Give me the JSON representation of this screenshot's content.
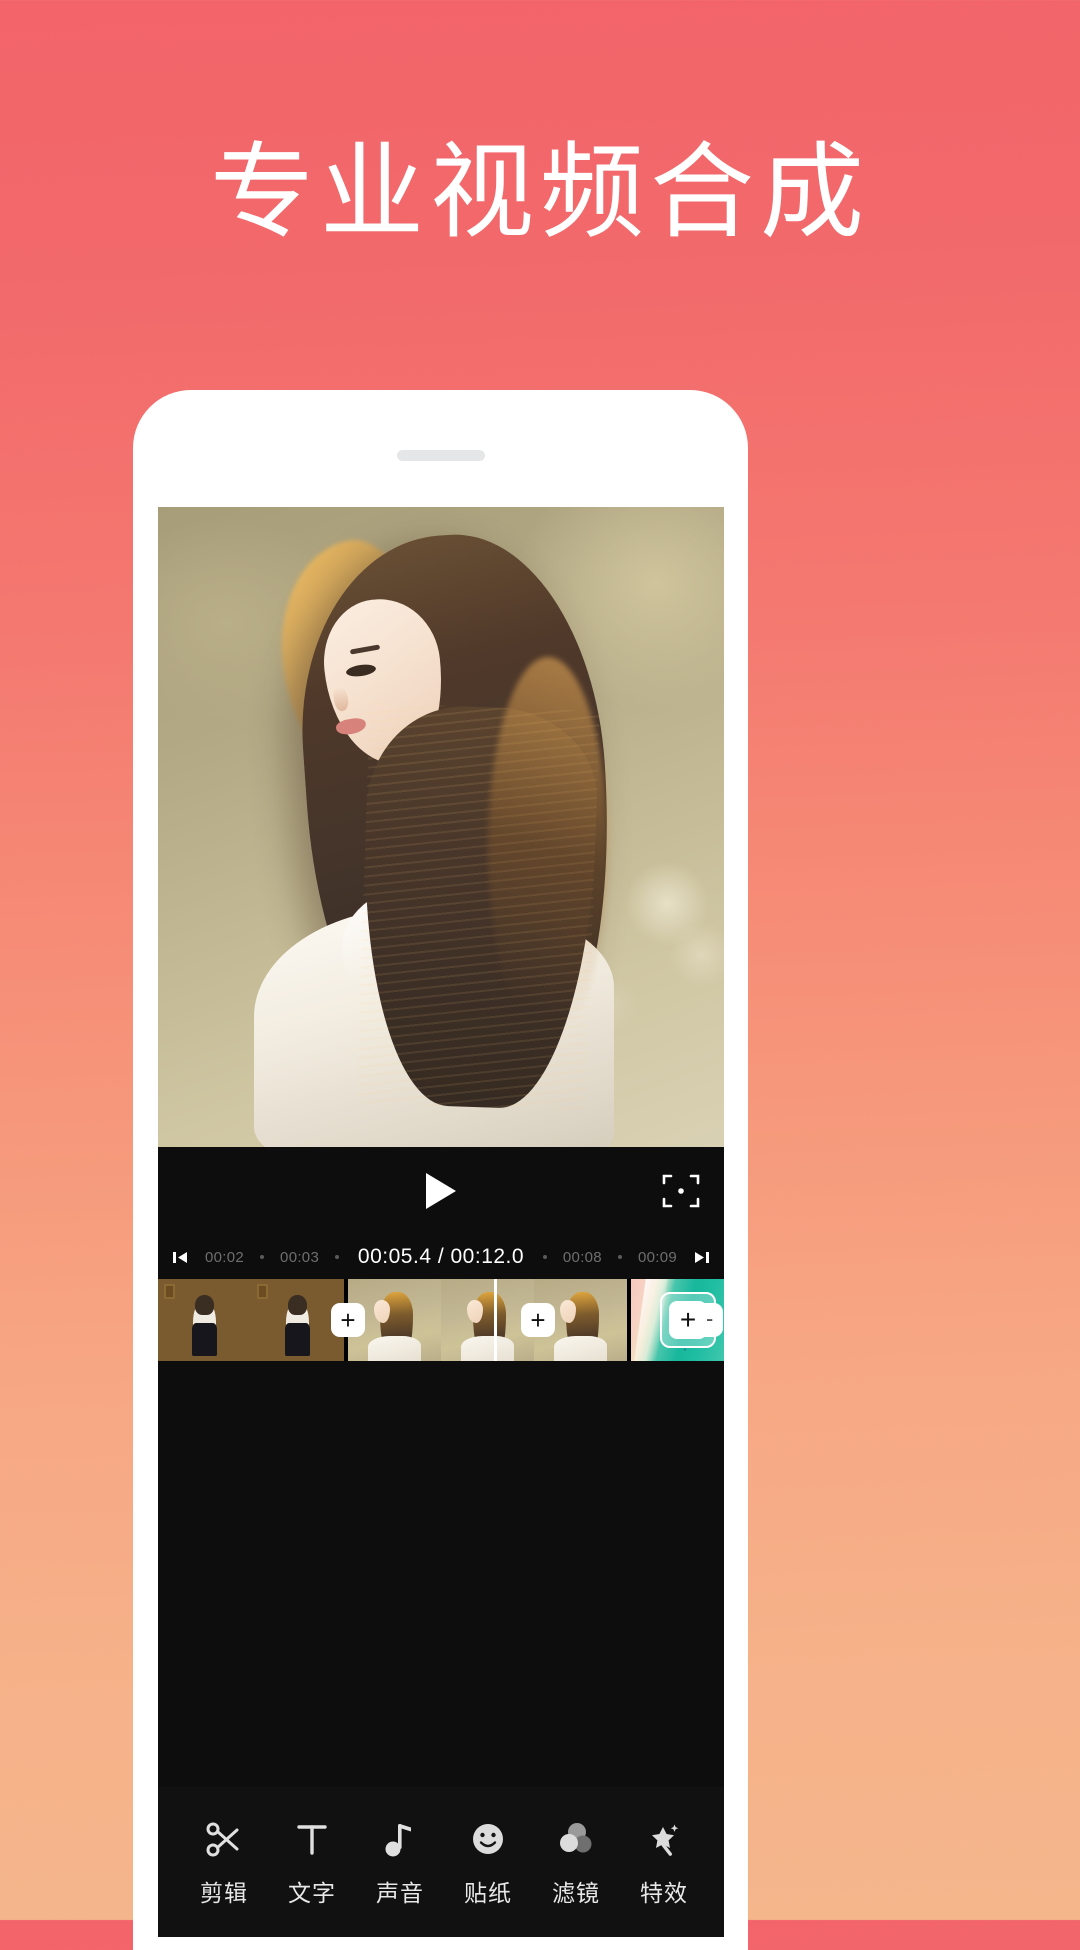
{
  "page": {
    "headline": "专业视频合成",
    "background_top_color": "#f2646a",
    "background_bottom_color": "#f5b68c"
  },
  "phone": {
    "frame_color": "#ffffff",
    "speaker_name": "phone-speaker"
  },
  "app": {
    "preview": {
      "name": "video-preview"
    },
    "playback": {
      "play_label": "▶",
      "fullscreen_label": "⛶"
    },
    "ruler": {
      "skip_prev_label": "◀|",
      "skip_next_label": "|▶",
      "left_ticks": [
        "00:02",
        "00:03"
      ],
      "right_ticks": [
        "00:08",
        "00:09"
      ],
      "current_time": "00:05.4",
      "total_time": "00:12.0",
      "time_display": "00:05.4 / 00:12.0"
    },
    "timeline": {
      "add_transition_label": "+",
      "add_clip_label": "+",
      "clips": [
        {
          "name": "clip-indoor-portrait",
          "frames": 2
        },
        {
          "name": "clip-outdoor-golden",
          "frames": 3
        },
        {
          "name": "clip-beach-teal",
          "frames": 3
        }
      ]
    },
    "toolbar": {
      "items": [
        {
          "label": "剪辑",
          "icon": "scissors-icon"
        },
        {
          "label": "文字",
          "icon": "text-icon"
        },
        {
          "label": "声音",
          "icon": "music-note-icon"
        },
        {
          "label": "贴纸",
          "icon": "smiley-sticker-icon"
        },
        {
          "label": "滤镜",
          "icon": "filter-circles-icon"
        },
        {
          "label": "特效",
          "icon": "magic-wand-icon"
        }
      ]
    }
  }
}
